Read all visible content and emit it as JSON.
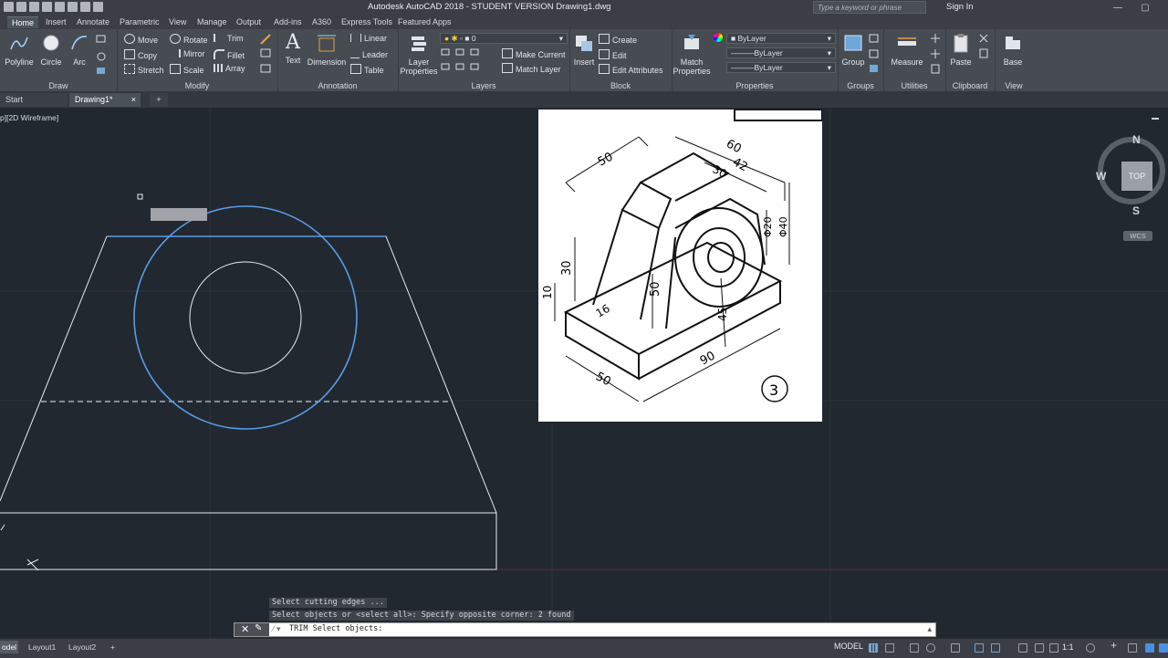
{
  "titlebar": {
    "title": "Autodesk AutoCAD 2018 - STUDENT VERSION    Drawing1.dwg",
    "search_placeholder": "Type a keyword or phrase",
    "sign_in": "Sign In"
  },
  "ribbon_tabs": [
    "Home",
    "Insert",
    "Annotate",
    "Parametric",
    "View",
    "Manage",
    "Output",
    "Add-ins",
    "A360",
    "Express Tools",
    "Featured Apps"
  ],
  "panels": {
    "draw": {
      "title": "Draw",
      "polyline": "Polyline",
      "circle": "Circle",
      "arc": "Arc"
    },
    "modify": {
      "title": "Modify",
      "move": "Move",
      "rotate": "Rotate",
      "trim": "Trim",
      "copy": "Copy",
      "mirror": "Mirror",
      "fillet": "Fillet",
      "stretch": "Stretch",
      "scale": "Scale",
      "array": "Array"
    },
    "annotation": {
      "title": "Annotation",
      "text": "Text",
      "dimension": "Dimension",
      "linear": "Linear",
      "leader": "Leader",
      "table": "Table"
    },
    "layers": {
      "title": "Layers",
      "layer_properties": "Layer Properties",
      "layer_value": "0",
      "make_current": "Make Current",
      "match_layer": "Match Layer"
    },
    "block": {
      "title": "Block",
      "insert": "Insert",
      "create": "Create",
      "edit": "Edit",
      "edit_attributes": "Edit Attributes"
    },
    "properties": {
      "title": "Properties",
      "match_properties": "Match Properties",
      "color": "ByLayer",
      "linetype": "ByLayer",
      "lineweight": "ByLayer"
    },
    "groups": {
      "title": "Groups",
      "group": "Group"
    },
    "utilities": {
      "title": "Utilities",
      "measure": "Measure"
    },
    "clipboard": {
      "title": "Clipboard",
      "paste": "Paste"
    },
    "view": {
      "title": "View",
      "base": "Base"
    }
  },
  "doc_tabs": {
    "start": "Start",
    "drawing": "Drawing1*"
  },
  "viewport": {
    "label": "p][2D Wireframe]"
  },
  "reference_image": {
    "dims": {
      "d50a": "50",
      "d60": "60",
      "d42": "42",
      "d30a": "30",
      "d30b": "30",
      "d10": "10",
      "d16": "16",
      "d50b": "50",
      "d45": "45",
      "d90": "90",
      "d50c": "50",
      "phi20": "Φ20",
      "phi40": "Φ40",
      "label": "3"
    }
  },
  "viewcube": {
    "n": "N",
    "w": "W",
    "s": "S",
    "top": "TOP",
    "wcs": "WCS"
  },
  "command": {
    "history1": "Select cutting edges ...",
    "history2": "Select objects or <select all>: Specify opposite corner: 2 found",
    "prompt": "TRIM Select objects:"
  },
  "statusbar": {
    "model_tab": "odel",
    "layout1": "Layout1",
    "layout2": "Layout2",
    "model": "MODEL",
    "scale": "1:1"
  },
  "colors": {
    "selected": "#4a90e2",
    "background": "#212830"
  }
}
